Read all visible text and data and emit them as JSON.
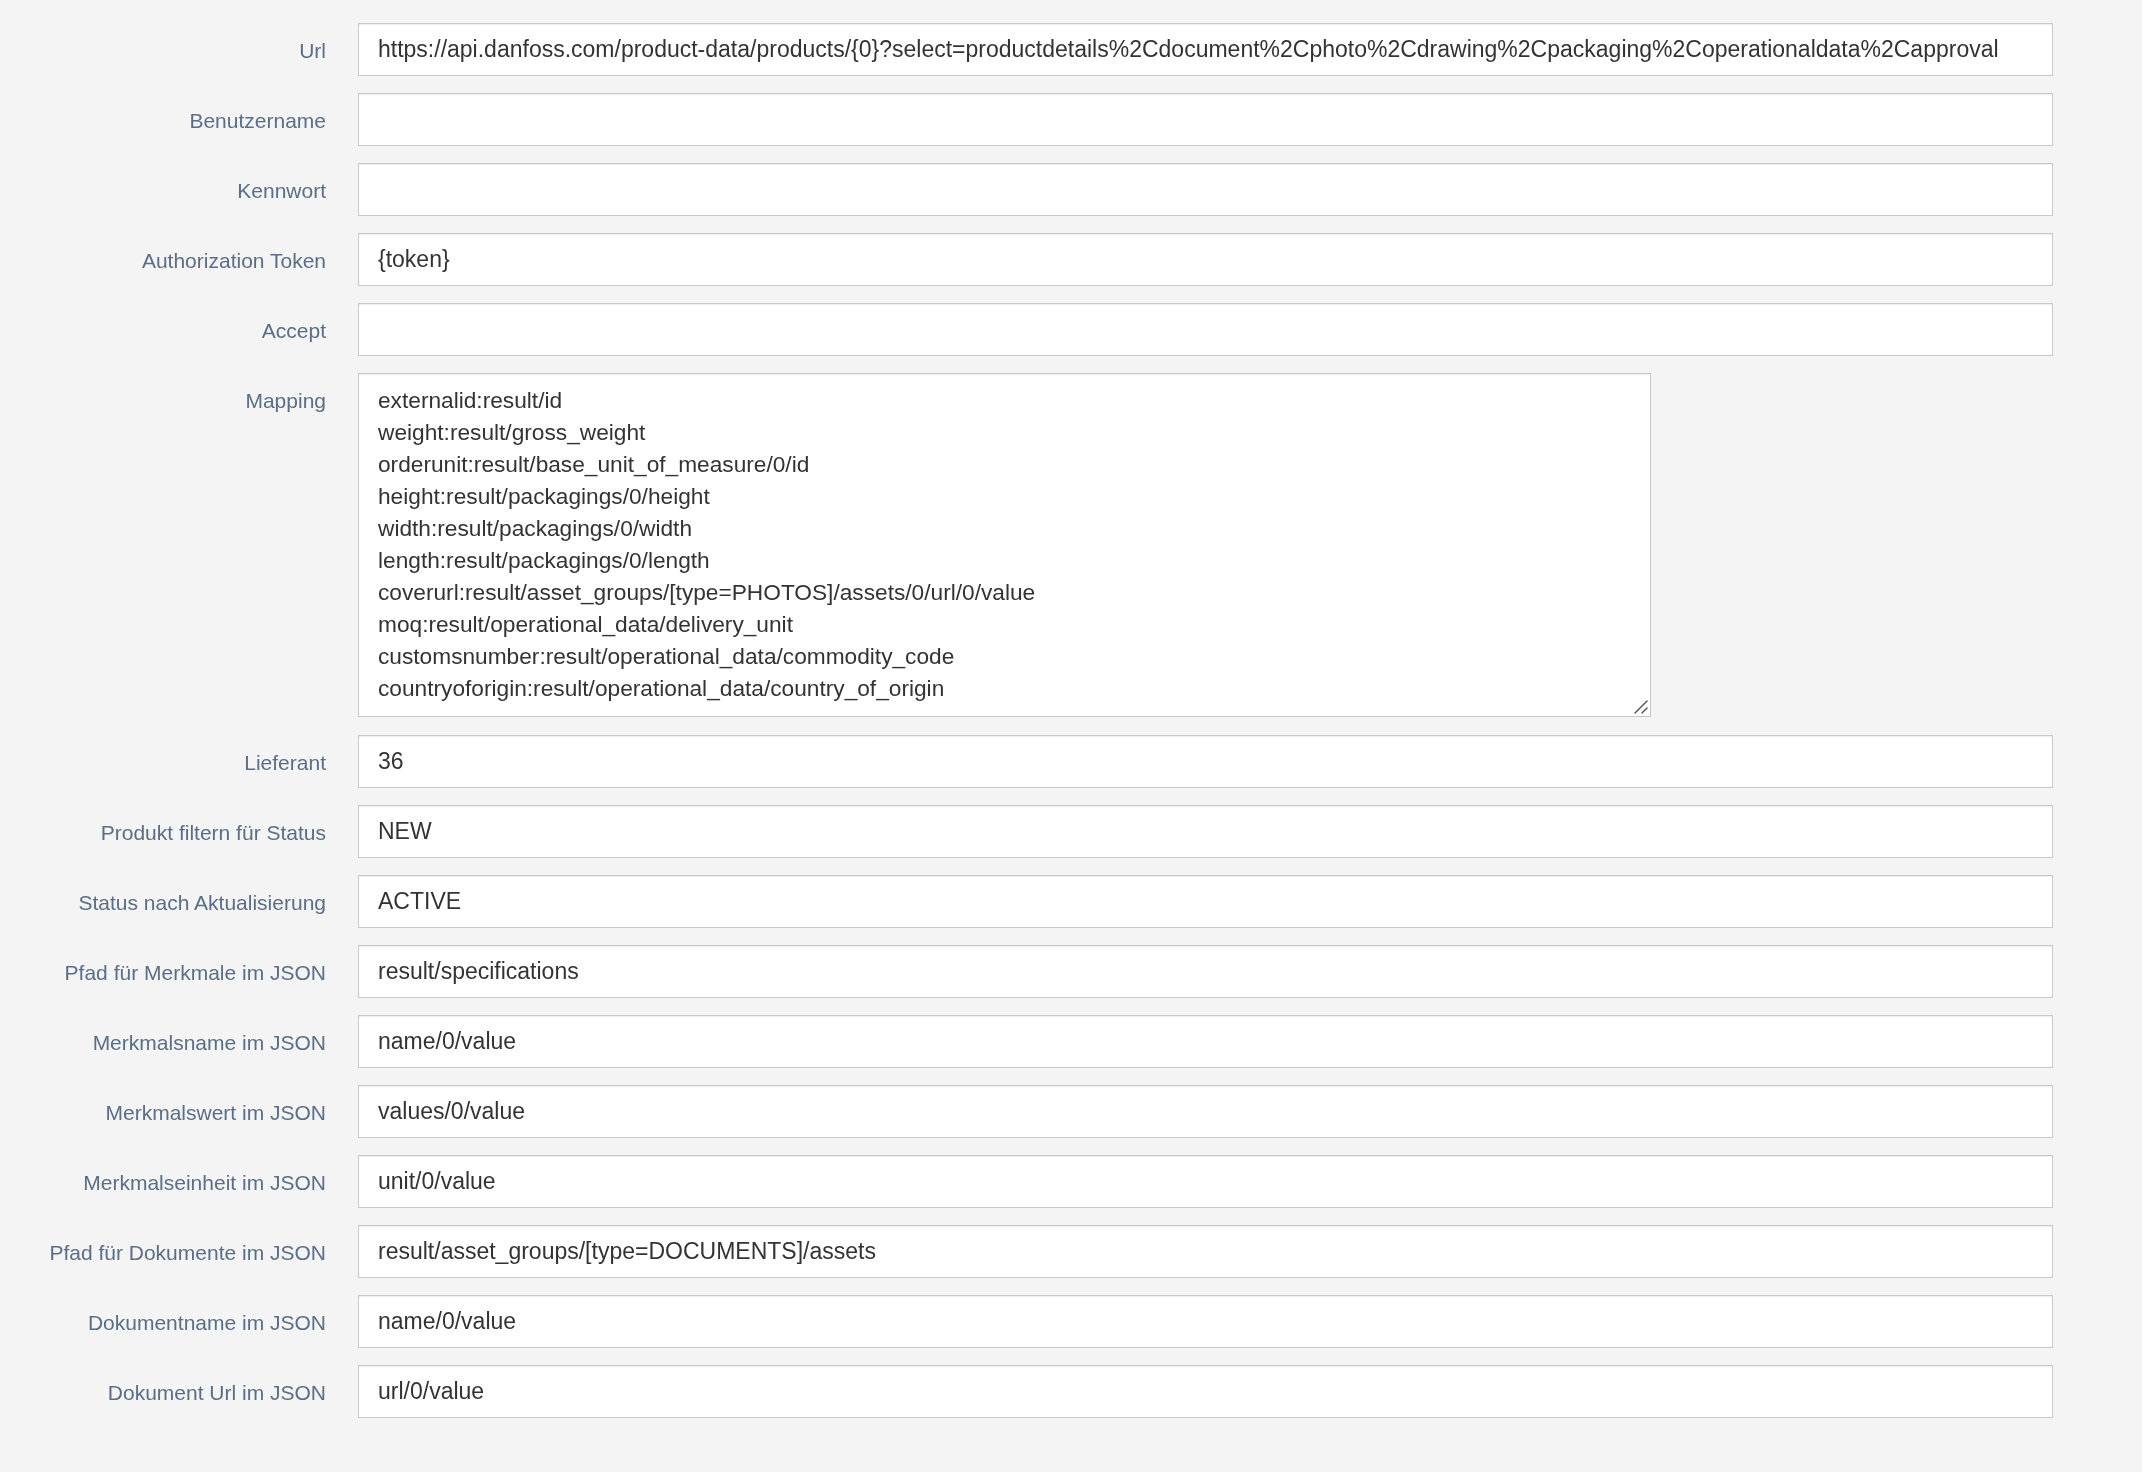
{
  "form": {
    "fields": [
      {
        "label": "Url",
        "kind": "input",
        "value": "https://api.danfoss.com/product-data/products/{0}?select=productdetails%2Cdocument%2Cphoto%2Cdrawing%2Cpackaging%2Coperationaldata%2Capproval"
      },
      {
        "label": "Benutzername",
        "kind": "input"
      },
      {
        "label": "Kennwort",
        "kind": "input"
      },
      {
        "label": "Authorization Token",
        "kind": "input",
        "value": "{token}"
      },
      {
        "label": "Accept",
        "kind": "input"
      },
      {
        "label": "Mapping",
        "kind": "textarea",
        "lines": [
          "externalid:result/id",
          "weight:result/gross_weight",
          "orderunit:result/base_unit_of_measure/0/id",
          "height:result/packagings/0/height",
          "width:result/packagings/0/width",
          "length:result/packagings/0/length",
          "coverurl:result/asset_groups/[type=PHOTOS]/assets/0/url/0/value",
          "moq:result/operational_data/delivery_unit",
          "customsnumber:result/operational_data/commodity_code",
          "countryoforigin:result/operational_data/country_of_origin"
        ]
      },
      {
        "label": "Lieferant",
        "kind": "input",
        "value": "36"
      },
      {
        "label": "Produkt filtern für Status",
        "kind": "input",
        "value": "NEW"
      },
      {
        "label": "Status nach Aktualisierung",
        "kind": "input",
        "value": "ACTIVE"
      },
      {
        "label": "Pfad für Merkmale im JSON",
        "kind": "input",
        "value": "result/specifications"
      },
      {
        "label": "Merkmalsname im JSON",
        "kind": "input",
        "value": "name/0/value"
      },
      {
        "label": "Merkmalswert im JSON",
        "kind": "input",
        "value": "values/0/value"
      },
      {
        "label": "Merkmalseinheit im JSON",
        "kind": "input",
        "value": "unit/0/value"
      },
      {
        "label": "Pfad für Dokumente im JSON",
        "kind": "input",
        "value": "result/asset_groups/[type=DOCUMENTS]/assets"
      },
      {
        "label": "Dokumentname im JSON",
        "kind": "input",
        "value": "name/0/value"
      },
      {
        "label": "Dokument Url im JSON",
        "kind": "input",
        "value": "url/0/value"
      }
    ]
  }
}
